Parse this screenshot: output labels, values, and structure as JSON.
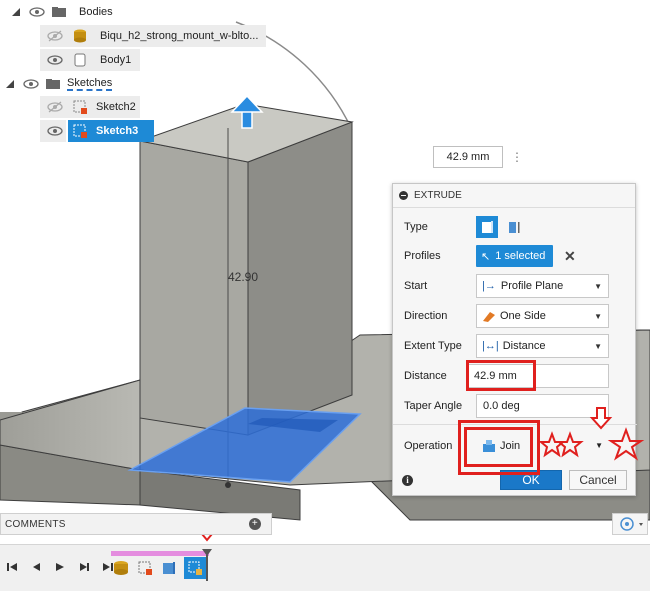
{
  "browser": {
    "bodies_label": "Bodies",
    "body_items": [
      "Biqu_h2_strong_mount_w-blto...",
      "Body1"
    ],
    "sketches_label": "Sketches",
    "sketch_items": [
      "Sketch2",
      "Sketch3"
    ]
  },
  "viewport": {
    "dimension_value": "42.9 mm",
    "dimension_label": "42.90"
  },
  "extrude": {
    "title": "EXTRUDE",
    "rows": {
      "type_label": "Type",
      "profiles_label": "Profiles",
      "profiles_value": "1 selected",
      "start_label": "Start",
      "start_value": "Profile Plane",
      "direction_label": "Direction",
      "direction_value": "One Side",
      "extent_label": "Extent Type",
      "extent_value": "Distance",
      "distance_label": "Distance",
      "distance_value": "42.9 mm",
      "taper_label": "Taper Angle",
      "taper_value": "0.0 deg",
      "operation_label": "Operation",
      "operation_value": "Join"
    },
    "ok_label": "OK",
    "cancel_label": "Cancel"
  },
  "comments": {
    "label": "COMMENTS"
  },
  "colors": {
    "accent": "#1e8ad6",
    "annotation": "#e0201e",
    "selection_face": "#2e6fd8"
  },
  "icons": [
    "eye-icon",
    "folder-icon",
    "body-icon",
    "sketch-icon",
    "extrude-arrow-icon",
    "play-icon",
    "info-icon",
    "star-icon"
  ]
}
